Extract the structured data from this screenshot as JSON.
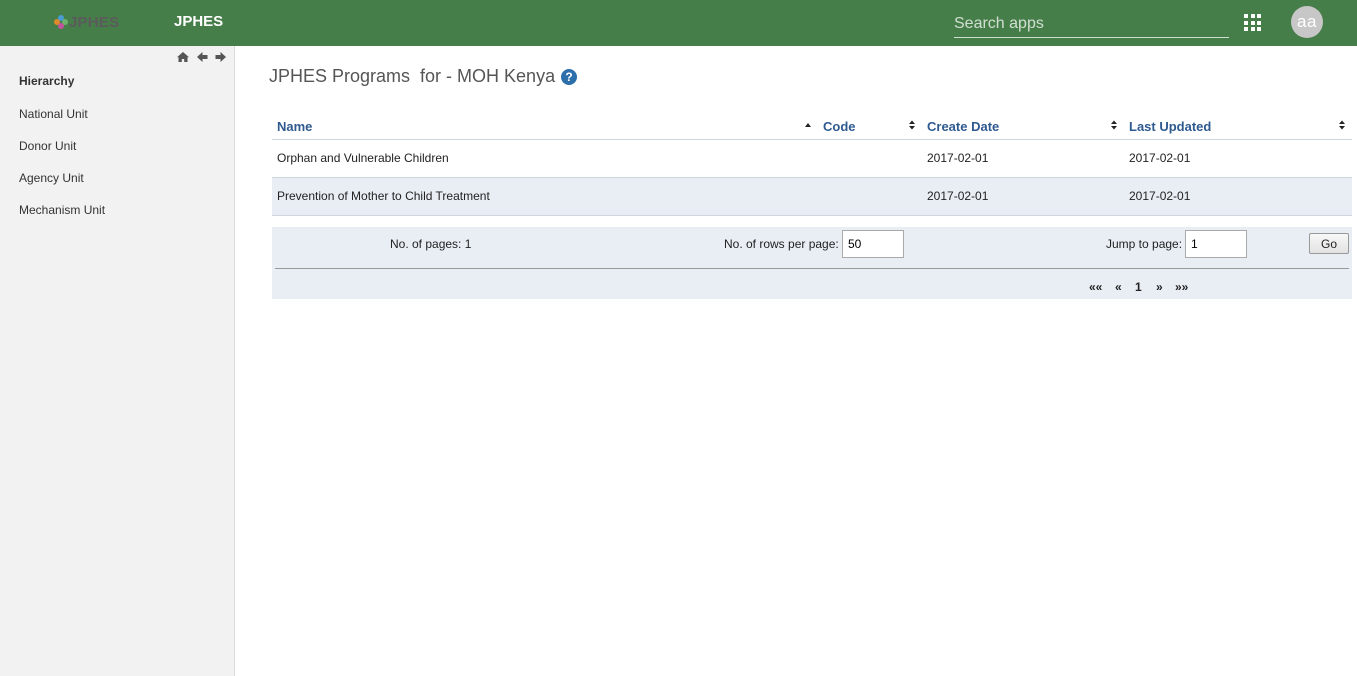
{
  "header": {
    "logo_text": "JPHES",
    "app_title": "JPHES",
    "search_placeholder": "Search apps",
    "avatar_initials": "aa",
    "bg_color": "#467e4a"
  },
  "sidebar": {
    "heading": "Hierarchy",
    "items": [
      {
        "label": "National Unit"
      },
      {
        "label": "Donor Unit"
      },
      {
        "label": "Agency Unit"
      },
      {
        "label": "Mechanism Unit"
      }
    ],
    "tools": [
      "home-icon",
      "arrow-left-icon",
      "arrow-right-icon"
    ]
  },
  "main": {
    "title": "JPHES Programs  for - MOH Kenya",
    "table": {
      "columns": [
        "Name",
        "Code",
        "Create Date",
        "Last Updated"
      ],
      "rows": [
        {
          "name": "Orphan and Vulnerable Children",
          "code": "",
          "create_date": "2017-02-01",
          "last_updated": "2017-02-01"
        },
        {
          "name": "Prevention of Mother to Child Treatment",
          "code": "",
          "create_date": "2017-02-01",
          "last_updated": "2017-02-01"
        }
      ]
    },
    "pager": {
      "pages_label": "No. of pages: 1",
      "rows_label": "No. of rows per page:",
      "rows_value": "50",
      "jump_label": "Jump to page:",
      "jump_value": "1",
      "go_label": "Go",
      "first": "««",
      "prev": "«",
      "current": "1",
      "next": "»",
      "last": "»»"
    }
  }
}
